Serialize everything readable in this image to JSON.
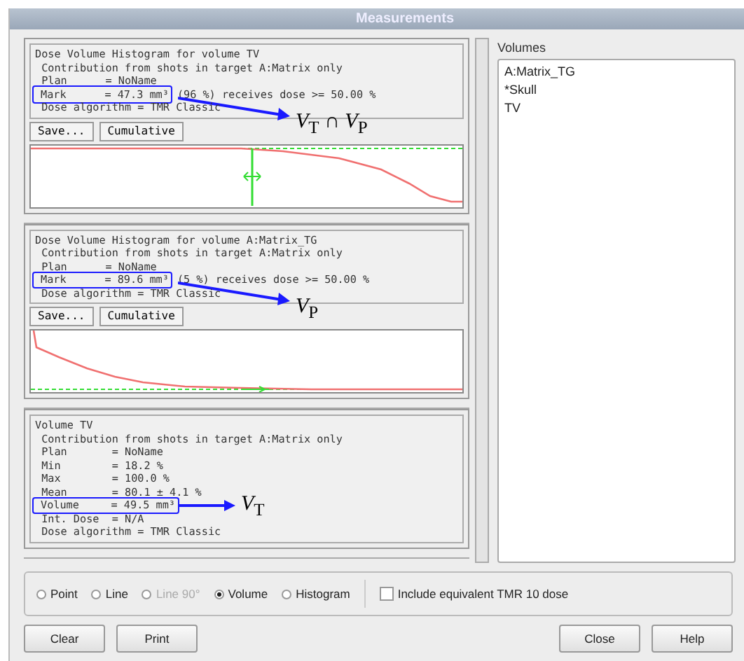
{
  "window": {
    "title": "Measurements"
  },
  "panels": [
    {
      "kind": "histogram",
      "lines": [
        {
          "text": "Dose Volume Histogram for volume TV"
        },
        {
          "text": " Contribution from shots in target A:Matrix only"
        },
        {
          "text": " Plan      = NoName"
        },
        {
          "text": "Mark      = 47.3 mm³",
          "rest": "(96 %) receives dose >= 50.00 %",
          "annotation": "*V*$_{T}$ ∩ *V*$_{P}$"
        },
        {
          "text": " Dose algorithm = TMR Classic"
        }
      ],
      "buttons": [
        "Save...",
        "Cumulative"
      ]
    },
    {
      "kind": "histogram",
      "lines": [
        {
          "text": "Dose Volume Histogram for volume A:Matrix_TG"
        },
        {
          "text": " Contribution from shots in target A:Matrix only"
        },
        {
          "text": " Plan      = NoName"
        },
        {
          "text": "Mark      = 89.6 mm³",
          "rest": "(5 %) receives dose >= 50.00 %",
          "annotation": "*V*$_{P}$"
        },
        {
          "text": " Dose algorithm = TMR Classic"
        }
      ],
      "buttons": [
        "Save...",
        "Cumulative"
      ]
    },
    {
      "kind": "info",
      "lines": [
        {
          "text": "Volume TV"
        },
        {
          "text": " Contribution from shots in target A:Matrix only"
        },
        {
          "text": " Plan       = NoName"
        },
        {
          "text": " Min        = 18.2 %"
        },
        {
          "text": " Max        = 100.0 %"
        },
        {
          "text": " Mean       = 80.1 ± 4.1 %"
        },
        {
          "text": "Volume     = 49.5 mm³",
          "annotation": "*V*$_{T}$"
        },
        {
          "text": " Int. Dose  = N/A"
        },
        {
          "text": " Dose algorithm = TMR Classic"
        }
      ]
    }
  ],
  "volumes": {
    "title": "Volumes",
    "items": [
      "A:Matrix_TG",
      "*Skull",
      "TV"
    ]
  },
  "modes": [
    {
      "label": "Point",
      "selected": false,
      "disabled": false
    },
    {
      "label": "Line",
      "selected": false,
      "disabled": false
    },
    {
      "label": "Line 90°",
      "selected": false,
      "disabled": true
    },
    {
      "label": "Volume",
      "selected": true,
      "disabled": false
    },
    {
      "label": "Histogram",
      "selected": false,
      "disabled": false
    }
  ],
  "include_tmr": {
    "label": "Include equivalent TMR 10 dose",
    "checked": false
  },
  "buttons_left": [
    "Clear",
    "Print"
  ],
  "buttons_right": [
    "Close",
    "Help"
  ]
}
